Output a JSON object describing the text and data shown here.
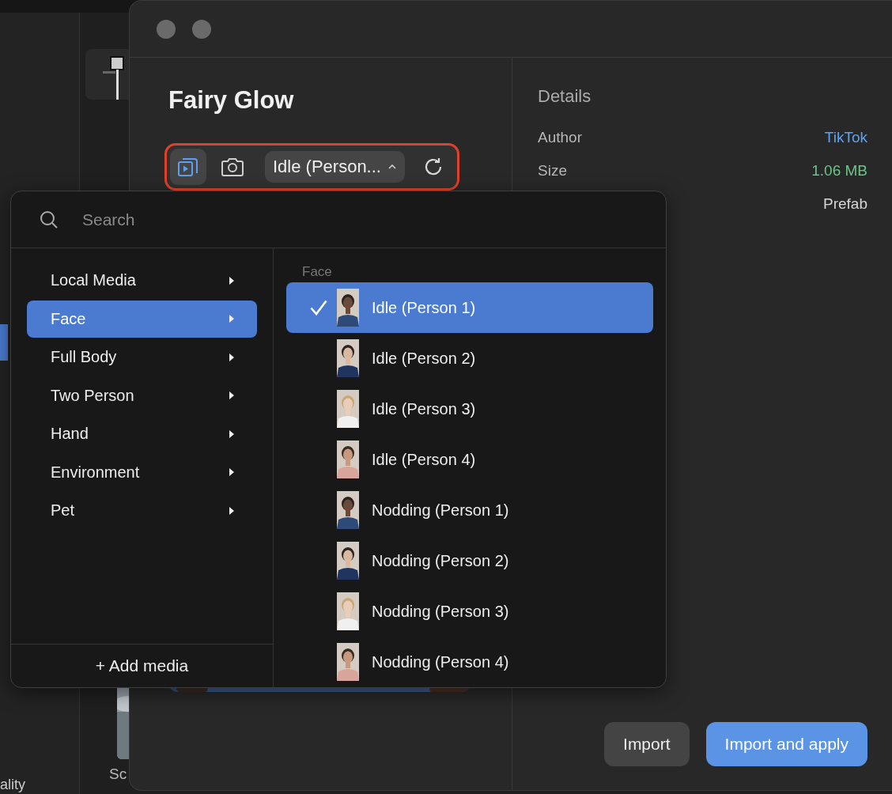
{
  "background_app": {
    "texts": [
      "Sc",
      "ality"
    ]
  },
  "window": {
    "title": "Fairy Glow",
    "toolbar": {
      "highlighted": true,
      "modes": [
        {
          "kind": "video",
          "selected": true
        },
        {
          "kind": "camera",
          "selected": false
        }
      ],
      "preset": "Idle (Person..."
    },
    "details": {
      "title": "Details",
      "rows": [
        {
          "label": "Author",
          "value": "TikTok",
          "color": "#5ea2ef"
        },
        {
          "label": "Size",
          "value": "1.06 MB",
          "color": "#6cc48a"
        },
        {
          "value": "Prefab",
          "color": "#d6d6d6"
        }
      ]
    },
    "buttons": [
      {
        "label": "Import",
        "kind": "secondary"
      },
      {
        "label": "Import and apply",
        "kind": "primary"
      }
    ]
  },
  "popup": {
    "search": {
      "placeholder": "Search"
    },
    "categories": [
      {
        "label": "Local Media",
        "selected": false
      },
      {
        "label": "Face",
        "selected": true
      },
      {
        "label": "Full Body",
        "selected": false
      },
      {
        "label": "Two Person",
        "selected": false
      },
      {
        "label": "Hand",
        "selected": false
      },
      {
        "label": "Environment",
        "selected": false
      },
      {
        "label": "Pet",
        "selected": false
      }
    ],
    "add_media": "+ Add media",
    "section": "Face",
    "items": [
      {
        "label": "Idle (Person 1)",
        "selected": true
      },
      {
        "label": "Idle (Person 2)",
        "selected": false
      },
      {
        "label": "Idle (Person 3)",
        "selected": false
      },
      {
        "label": "Idle (Person 4)",
        "selected": false
      },
      {
        "label": "Nodding (Person 1)",
        "selected": false
      },
      {
        "label": "Nodding (Person 2)",
        "selected": false
      },
      {
        "label": "Nodding (Person 3)",
        "selected": false
      },
      {
        "label": "Nodding (Person 4)",
        "selected": false
      }
    ]
  }
}
